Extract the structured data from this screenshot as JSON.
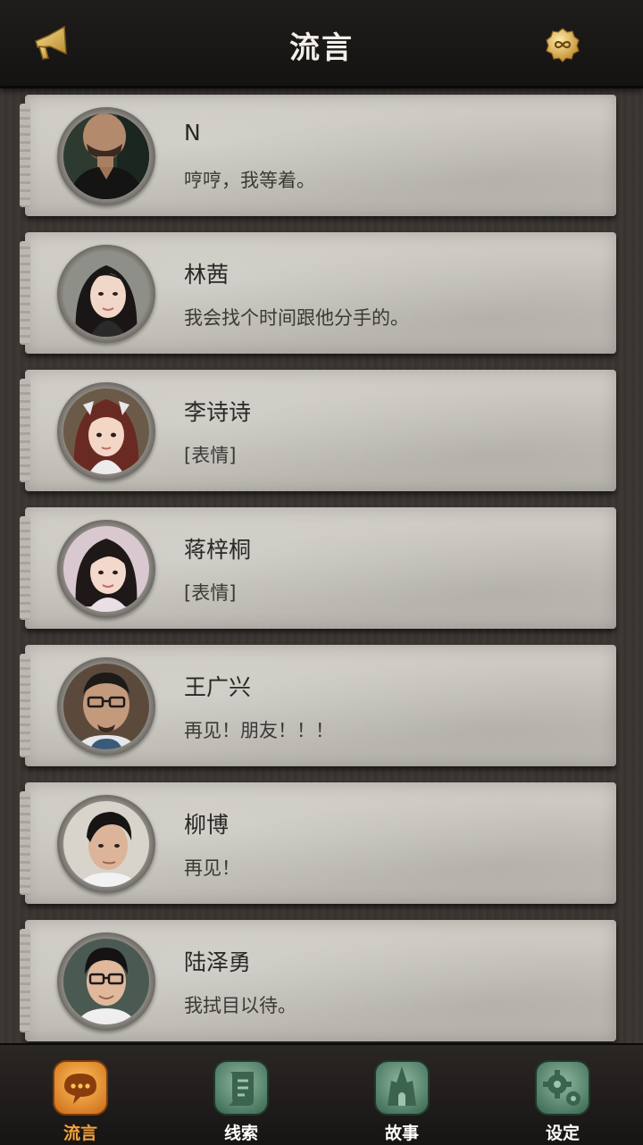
{
  "header": {
    "title": "流言",
    "left_icon": "megaphone-icon",
    "right_icon": "infinity-coin-icon"
  },
  "contacts": [
    {
      "name": "N",
      "message": "哼哼，我等着。"
    },
    {
      "name": "林茜",
      "message": "我会找个时间跟他分手的。"
    },
    {
      "name": "李诗诗",
      "message": "[表情]"
    },
    {
      "name": "蒋梓桐",
      "message": "[表情]"
    },
    {
      "name": "王广兴",
      "message": "再见！朋友！！！"
    },
    {
      "name": "柳博",
      "message": "再见！"
    },
    {
      "name": "陆泽勇",
      "message": "我拭目以待。"
    }
  ],
  "tabs": [
    {
      "label": "流言",
      "icon": "speech-bubble-icon",
      "active": true
    },
    {
      "label": "线索",
      "icon": "scroll-icon",
      "active": false
    },
    {
      "label": "故事",
      "icon": "cathedral-icon",
      "active": false
    },
    {
      "label": "设定",
      "icon": "gears-icon",
      "active": false
    }
  ],
  "colors": {
    "active_tab": "#f5a23a",
    "header_bg": "#1a1817",
    "card_bg": "#c8c5be"
  }
}
